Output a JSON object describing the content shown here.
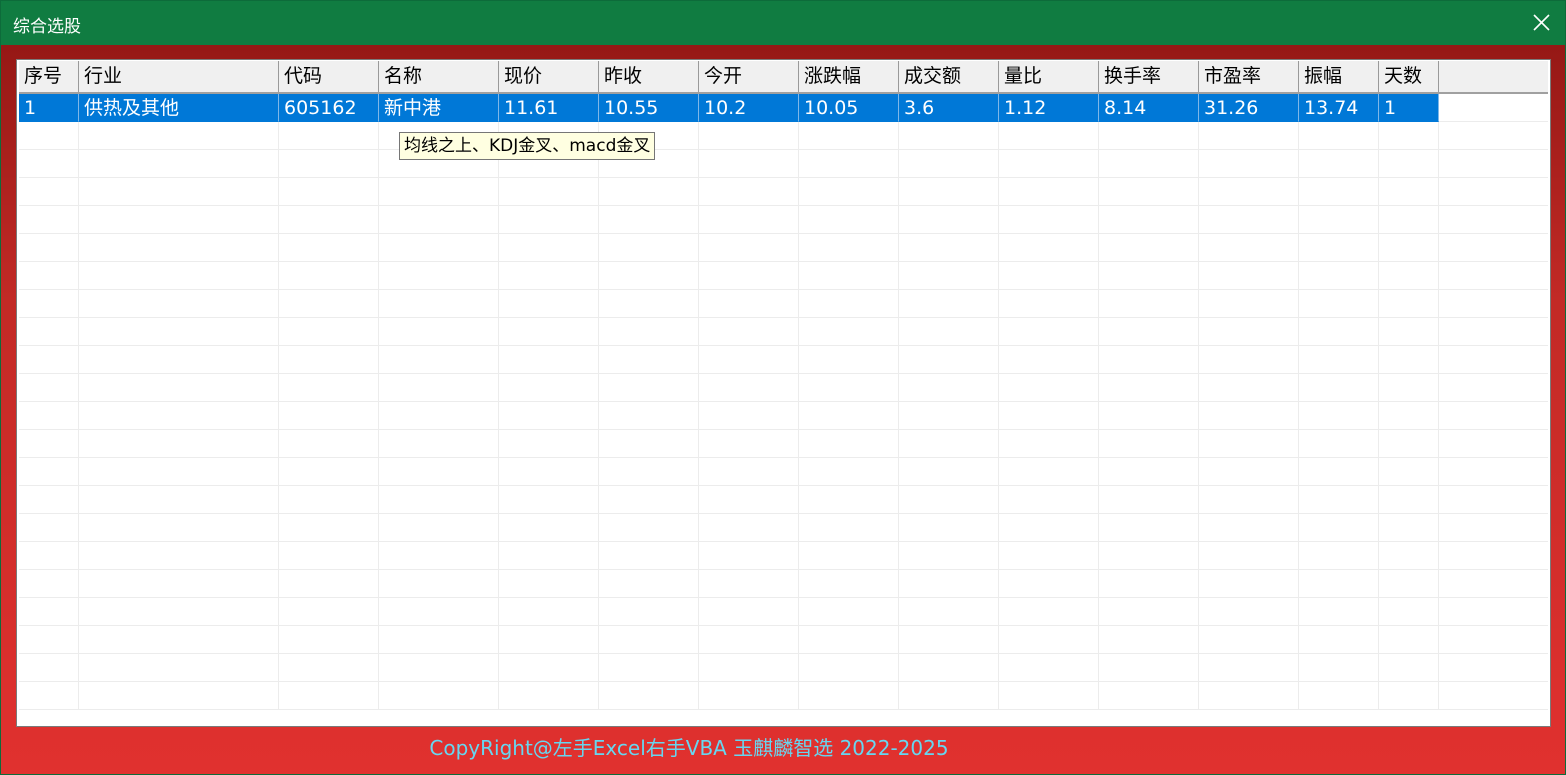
{
  "window": {
    "title": "综合选股"
  },
  "grid": {
    "columns": [
      "序号",
      "行业",
      "代码",
      "名称",
      "现价",
      "昨收",
      "今开",
      "涨跌幅",
      "成交额",
      "量比",
      "换手率",
      "市盈率",
      "振幅",
      "天数"
    ],
    "rows": [
      [
        "1",
        "供热及其他",
        "605162",
        "新中港",
        "11.61",
        "10.55",
        "10.2",
        "10.05",
        "3.6",
        "1.12",
        "8.14",
        "31.26",
        "13.74",
        "1"
      ]
    ],
    "selected_row": 0
  },
  "tooltip": {
    "text": "均线之上、KDJ金叉、macd金叉"
  },
  "footer": {
    "text": "CopyRight@左手Excel右手VBA 玉麒麟智选  2022-2025"
  },
  "colors": {
    "titlebar": "#107c41",
    "frame_top": "#8e1512",
    "frame_bottom": "#e1312f",
    "selection": "#0078d7",
    "footer_text": "#67d6f0"
  },
  "icons": {
    "close": "close-icon"
  }
}
